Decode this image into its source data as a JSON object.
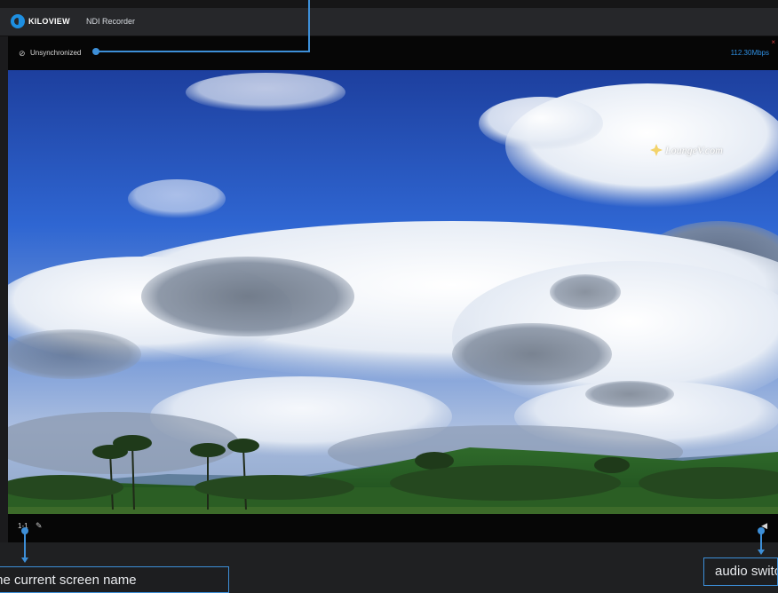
{
  "app": {
    "brand": "KILOVIEW",
    "title": "NDI Recorder"
  },
  "status": {
    "sync_icon": "⊘",
    "sync_text": "Unsynchronized",
    "bitrate": "112.30Mbps",
    "close": "×"
  },
  "video": {
    "watermark": "LoungeV.com",
    "watermark_icon": "star-icon"
  },
  "controls": {
    "screen_label": "1-1",
    "edit_icon": "✎",
    "audio_icon": "◀"
  },
  "callouts": {
    "screen_name": "Edit the current screen name",
    "audio": "audio switch"
  },
  "colors": {
    "accent": "#3d8fd8",
    "bitrate": "#2f8ee0",
    "close": "#d04040"
  }
}
